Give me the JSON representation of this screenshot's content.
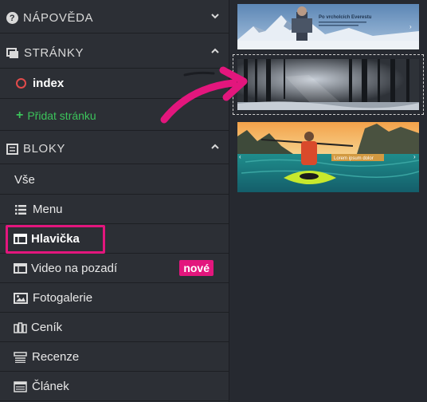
{
  "sidebar": {
    "help": {
      "label": "NÁPOVĚDA",
      "icon": "question-circle-icon"
    },
    "pages": {
      "label": "STRÁNKY",
      "icon": "pages-icon",
      "items": [
        {
          "label": "index",
          "icon": "circle-outline-icon"
        }
      ],
      "add_label": "Přidat stránku"
    },
    "blocks": {
      "label": "BLOKY",
      "icon": "list-box-icon",
      "items": [
        {
          "label": "Vše",
          "icon": ""
        },
        {
          "label": "Menu",
          "icon": "list-icon"
        },
        {
          "label": "Hlavička",
          "icon": "header-layout-icon",
          "selected": true
        },
        {
          "label": "Video na pozadí",
          "icon": "header-layout-icon",
          "badge": "nové"
        },
        {
          "label": "Fotogalerie",
          "icon": "image-icon"
        },
        {
          "label": "Ceník",
          "icon": "pricing-icon"
        },
        {
          "label": "Recenze",
          "icon": "reviews-icon"
        },
        {
          "label": "Článek",
          "icon": "article-icon"
        }
      ]
    }
  },
  "thumbnails": [
    {
      "title": "Po vrcholcích Everestu",
      "theme": "mountain"
    },
    {
      "title": "",
      "theme": "forest"
    },
    {
      "title": "Lorem ipsum dolor",
      "theme": "kayak"
    }
  ],
  "colors": {
    "accent_pink": "#e3167d",
    "add_green": "#3cc35b",
    "page_dot": "#e24b4b"
  }
}
